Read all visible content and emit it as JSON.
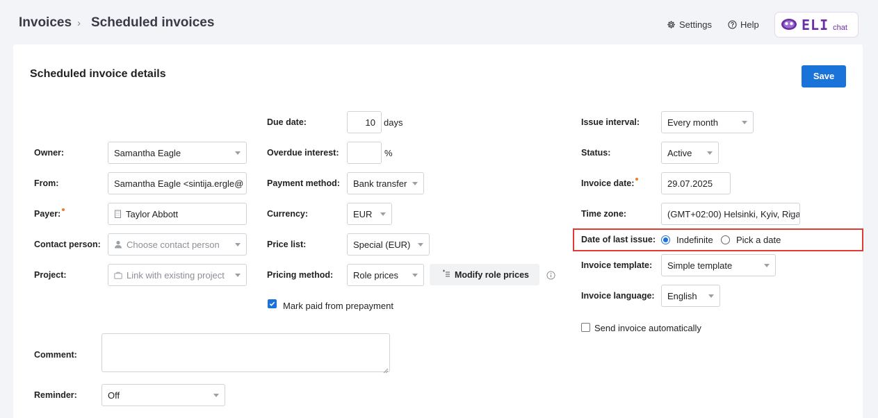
{
  "breadcrumb": {
    "root": "Invoices",
    "separator": "›",
    "current": "Scheduled invoices"
  },
  "top_nav": {
    "settings": "Settings",
    "help": "Help",
    "logo_text": "ELI",
    "logo_sub": "chat"
  },
  "page": {
    "title": "Scheduled invoice details",
    "save_label": "Save"
  },
  "left": {
    "owner": {
      "label": "Owner:",
      "value": "Samantha Eagle"
    },
    "from": {
      "label": "From:",
      "value": "Samantha Eagle <sintija.ergle@"
    },
    "payer": {
      "label": "Payer:",
      "value": "Taylor Abbott"
    },
    "contact": {
      "label": "Contact person:",
      "placeholder": "Choose contact person"
    },
    "project": {
      "label": "Project:",
      "placeholder": "Link with existing project"
    },
    "comment": {
      "label": "Comment:",
      "value": ""
    },
    "reminder": {
      "label": "Reminder:",
      "value": "Off"
    }
  },
  "middle": {
    "due_date": {
      "label": "Due date:",
      "value": "10",
      "unit": "days"
    },
    "overdue_interest": {
      "label": "Overdue interest:",
      "value": "",
      "unit": "%"
    },
    "payment_method": {
      "label": "Payment method:",
      "value": "Bank transfer"
    },
    "currency": {
      "label": "Currency:",
      "value": "EUR"
    },
    "price_list": {
      "label": "Price list:",
      "value": "Special (EUR)"
    },
    "pricing_method": {
      "label": "Pricing method:",
      "value": "Role prices",
      "modify_label": "Modify role prices"
    },
    "mark_paid": {
      "label": "Mark paid from prepayment",
      "checked": true
    }
  },
  "right": {
    "issue_interval": {
      "label": "Issue interval:",
      "value": "Every month"
    },
    "status": {
      "label": "Status:",
      "value": "Active"
    },
    "invoice_date": {
      "label": "Invoice date:",
      "value": "29.07.2025"
    },
    "time_zone": {
      "label": "Time zone:",
      "value": "(GMT+02:00) Helsinki, Kyiv, Riga"
    },
    "date_of_last_issue": {
      "label": "Date of last issue:",
      "option_indefinite": "Indefinite",
      "option_pick": "Pick a date",
      "selected": "Indefinite"
    },
    "invoice_template": {
      "label": "Invoice template:",
      "value": "Simple template"
    },
    "invoice_language": {
      "label": "Invoice language:",
      "value": "English"
    },
    "send_auto": {
      "label": "Send invoice automatically",
      "checked": false
    }
  },
  "colors": {
    "accent": "#1a73d9",
    "required_dot": "#f07b2a",
    "highlight": "#e03a33",
    "brand": "#6b2fa8"
  }
}
